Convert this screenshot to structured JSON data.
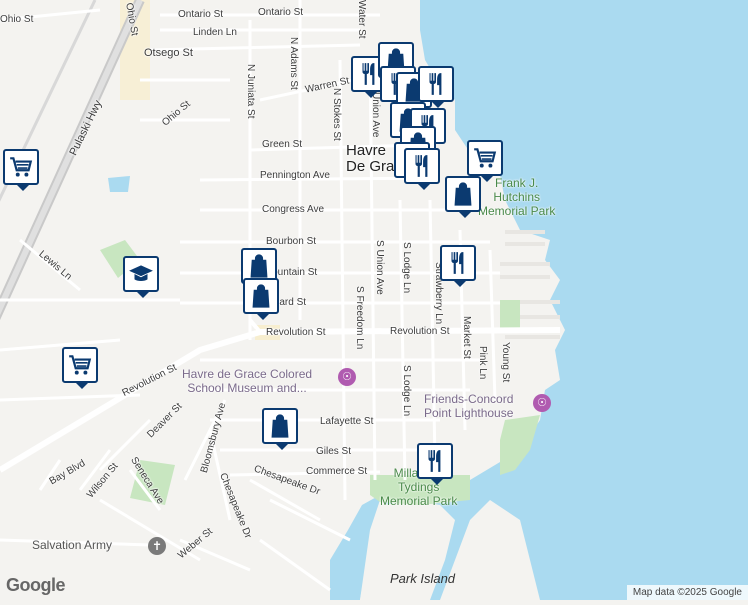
{
  "map": {
    "colors": {
      "water": "#aadaf0",
      "land": "#f4f3f0",
      "park": "#c8e6c0",
      "marker": "#0b3a70",
      "museum": "#b05bb0",
      "church": "#7a7a7a"
    },
    "city": {
      "line1": "Havre",
      "line2": "De Grace"
    },
    "streets": {
      "ontario": "Ontario St",
      "ontario2": "Ontario St",
      "linden": "Linden Ln",
      "otsego": "Otsego St",
      "ohio": "Ohio St",
      "ohio2": "Ohio St",
      "warren": "Warren St",
      "njuniata": "N Juniata St",
      "nadams": "N Adams St",
      "nstokes": "N Stokes St",
      "unionave": "Union Ave",
      "water": "Water St",
      "green": "Green St",
      "pennington": "Pennington Ave",
      "congress": "Congress Ave",
      "bourbon": "Bourbon St",
      "fountain": "Fountain St",
      "alliard": "Alliard St",
      "revolution": "Revolution St",
      "revolution2": "Revolution St",
      "revolution3": "Revolution St",
      "sunion": "S Union Ave",
      "slodge": "S Lodge Ln",
      "sfreedom": "S Freedom Ln",
      "strawberry": "Strawberry Ln",
      "market": "Market St",
      "pink": "Pink Ln",
      "young": "Young St",
      "slodge2": "S Lodge Ln",
      "lafayette": "Lafayette St",
      "giles": "Giles St",
      "commerce": "Commerce St",
      "chesapeake": "Chesapeake Dr",
      "chesapeake2": "Chesapeake Dr",
      "bloomsbury": "Bloomsbury Ave",
      "deaver": "Deaver St",
      "wilson": "Wilson St",
      "seneca": "Seneca Ave",
      "weber": "Weber St",
      "bay": "Bay Blvd",
      "lewis": "Lewis Ln",
      "pulaski": "Pulaski Hwy"
    },
    "pois": {
      "museum_line1": "Havre de Grace Colored",
      "museum_line2": "School Museum and...",
      "lighthouse_line1": "Friends-Concord",
      "lighthouse_line2": "Point Lighthouse",
      "hutchins_line1": "Frank J.",
      "hutchins_line2": "Hutchins",
      "hutchins_line3": "Memorial Park",
      "tydings_line1": "Millard E.",
      "tydings_line2": "Tydings",
      "tydings_line3": "Memorial Park",
      "salvation": "Salvation Army",
      "park_island": "Park Island"
    },
    "attribution": "Map data ©2025 Google",
    "logo": "Google"
  }
}
